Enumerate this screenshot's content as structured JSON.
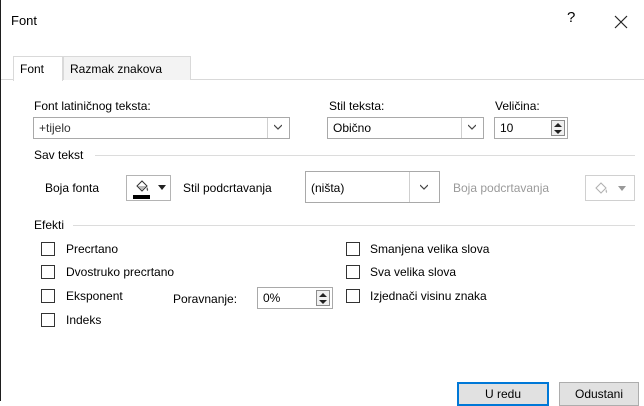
{
  "dialog": {
    "title": "Font",
    "help_label": "?",
    "close_label": "X"
  },
  "tabs": [
    {
      "label": "Font",
      "active": true
    },
    {
      "label": "Razmak znakova",
      "active": false
    }
  ],
  "latin_font": {
    "label": "Font latiničnog teksta:",
    "value": "+tijelo"
  },
  "style": {
    "label": "Stil teksta:",
    "value": "Obično"
  },
  "size": {
    "label": "Veličina:",
    "value": "10"
  },
  "all_text": {
    "section_label": "Sav tekst",
    "font_color_label": "Boja fonta",
    "font_color": "#000000",
    "underline_style_label": "Stil podcrtavanja",
    "underline_style_value": "(ništa)",
    "underline_color_label": "Boja podcrtavanja"
  },
  "effects": {
    "section_label": "Efekti",
    "left": [
      {
        "label": "Precrtano",
        "checked": false
      },
      {
        "label": "Dvostruko precrtano",
        "checked": false
      },
      {
        "label": "Eksponent",
        "checked": false
      },
      {
        "label": "Indeks",
        "checked": false
      }
    ],
    "right": [
      {
        "label": "Smanjena velika slova",
        "checked": false
      },
      {
        "label": "Sva velika slova",
        "checked": false
      },
      {
        "label": "Izjednači visinu znaka",
        "checked": false
      }
    ],
    "offset_label": "Poravnanje:",
    "offset_value": "0%"
  },
  "buttons": {
    "ok": "U redu",
    "cancel": "Odustani"
  },
  "colors": {
    "accent": "#0078d7",
    "disabled_text": "#9a9a9a"
  }
}
